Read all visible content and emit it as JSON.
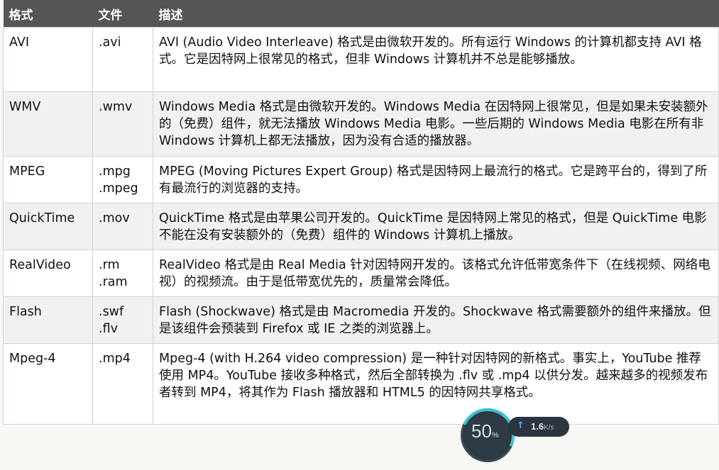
{
  "table": {
    "headers": [
      "格式",
      "文件",
      "描述"
    ],
    "rows": [
      {
        "format": "AVI",
        "files": [
          ".avi"
        ],
        "desc": "AVI (Audio Video Interleave) 格式是由微软开发的。所有运行 Windows 的计算机都支持 AVI 格式。它是因特网上很常见的格式，但非 Windows 计算机并不总是能够播放。"
      },
      {
        "format": "WMV",
        "files": [
          ".wmv"
        ],
        "desc": "Windows Media 格式是由微软开发的。Windows Media 在因特网上很常见，但是如果未安装额外的（免费）组件，就无法播放 Windows Media 电影。一些后期的 Windows Media 电影在所有非 Windows 计算机上都无法播放，因为没有合适的播放器。"
      },
      {
        "format": "MPEG",
        "files": [
          ".mpg",
          ".mpeg"
        ],
        "desc": "MPEG (Moving Pictures Expert Group) 格式是因特网上最流行的格式。它是跨平台的，得到了所有最流行的浏览器的支持。"
      },
      {
        "format": "QuickTime",
        "files": [
          ".mov"
        ],
        "desc": "QuickTime 格式是由苹果公司开发的。QuickTime 是因特网上常见的格式，但是 QuickTime 电影不能在没有安装额外的（免费）组件的 Windows 计算机上播放。"
      },
      {
        "format": "RealVideo",
        "files": [
          ".rm",
          ".ram"
        ],
        "desc": "RealVideo 格式是由 Real Media 针对因特网开发的。该格式允许低带宽条件下（在线视频、网络电视）的视频流。由于是低带宽优先的，质量常会降低。"
      },
      {
        "format": "Flash",
        "files": [
          ".swf",
          ".flv"
        ],
        "desc": "Flash (Shockwave) 格式是由 Macromedia 开发的。Shockwave 格式需要额外的组件来播放。但是该组件会预装到 Firefox 或 IE 之类的浏览器上。"
      },
      {
        "format": "Mpeg-4",
        "files": [
          ".mp4"
        ],
        "desc": "Mpeg-4 (with H.264 video compression) 是一种针对因特网的新格式。事实上，YouTube 推荐使用 MP4。YouTube 接收多种格式，然后全部转换为 .flv 或 .mp4 以供分发。越来越多的视频发布者转到 MP4，将其作为 Flash 播放器和 HTML5 的因特网共享格式。"
      }
    ]
  },
  "speed_widget": {
    "percent": "50",
    "percent_unit": "%",
    "arrow": "↑",
    "speed": "1.6",
    "speed_unit": "K/s"
  },
  "colors": {
    "header_bg": "#555555",
    "gauge_accent": "#39c4d6"
  }
}
